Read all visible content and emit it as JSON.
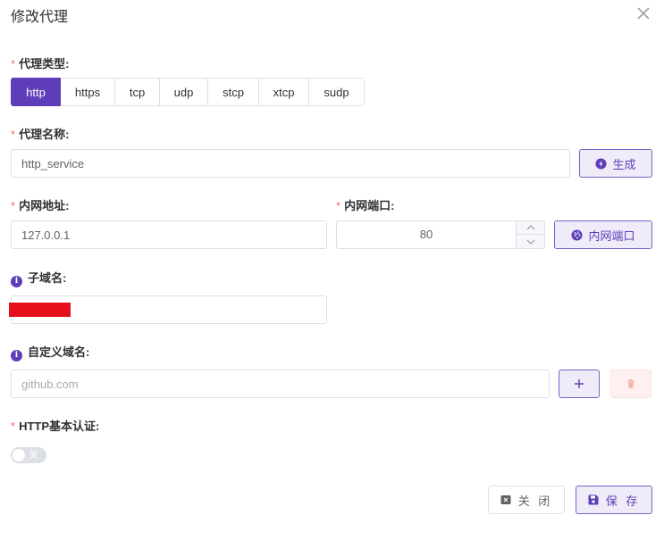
{
  "dialog": {
    "title": "修改代理"
  },
  "proxy_type": {
    "label": "代理类型:",
    "options": [
      "http",
      "https",
      "tcp",
      "udp",
      "stcp",
      "xtcp",
      "sudp"
    ],
    "selected": "http"
  },
  "proxy_name": {
    "label": "代理名称:",
    "value": "http_service",
    "generate_label": "生成"
  },
  "local_address": {
    "label": "内网地址:",
    "value": "127.0.0.1"
  },
  "local_port": {
    "label": "内网端口:",
    "value": "80",
    "button_label": "内网端口"
  },
  "subdomain": {
    "label": "子域名:",
    "value": ""
  },
  "custom_domain": {
    "label": "自定义域名:",
    "placeholder": "github.com"
  },
  "http_auth": {
    "label": "HTTP基本认证:",
    "switch_text": "关",
    "enabled": false
  },
  "footer": {
    "close_label": "关 闭",
    "save_label": "保 存"
  },
  "colors": {
    "accent": "#5e3eb8",
    "required": "#f56c6c",
    "redaction": "#e5101a"
  },
  "icons": [
    "close-icon",
    "lightning-icon",
    "globe-icon",
    "info-icon",
    "plus-icon",
    "trash-icon",
    "close-box-icon",
    "save-icon",
    "chevron-up-icon",
    "chevron-down-icon"
  ]
}
